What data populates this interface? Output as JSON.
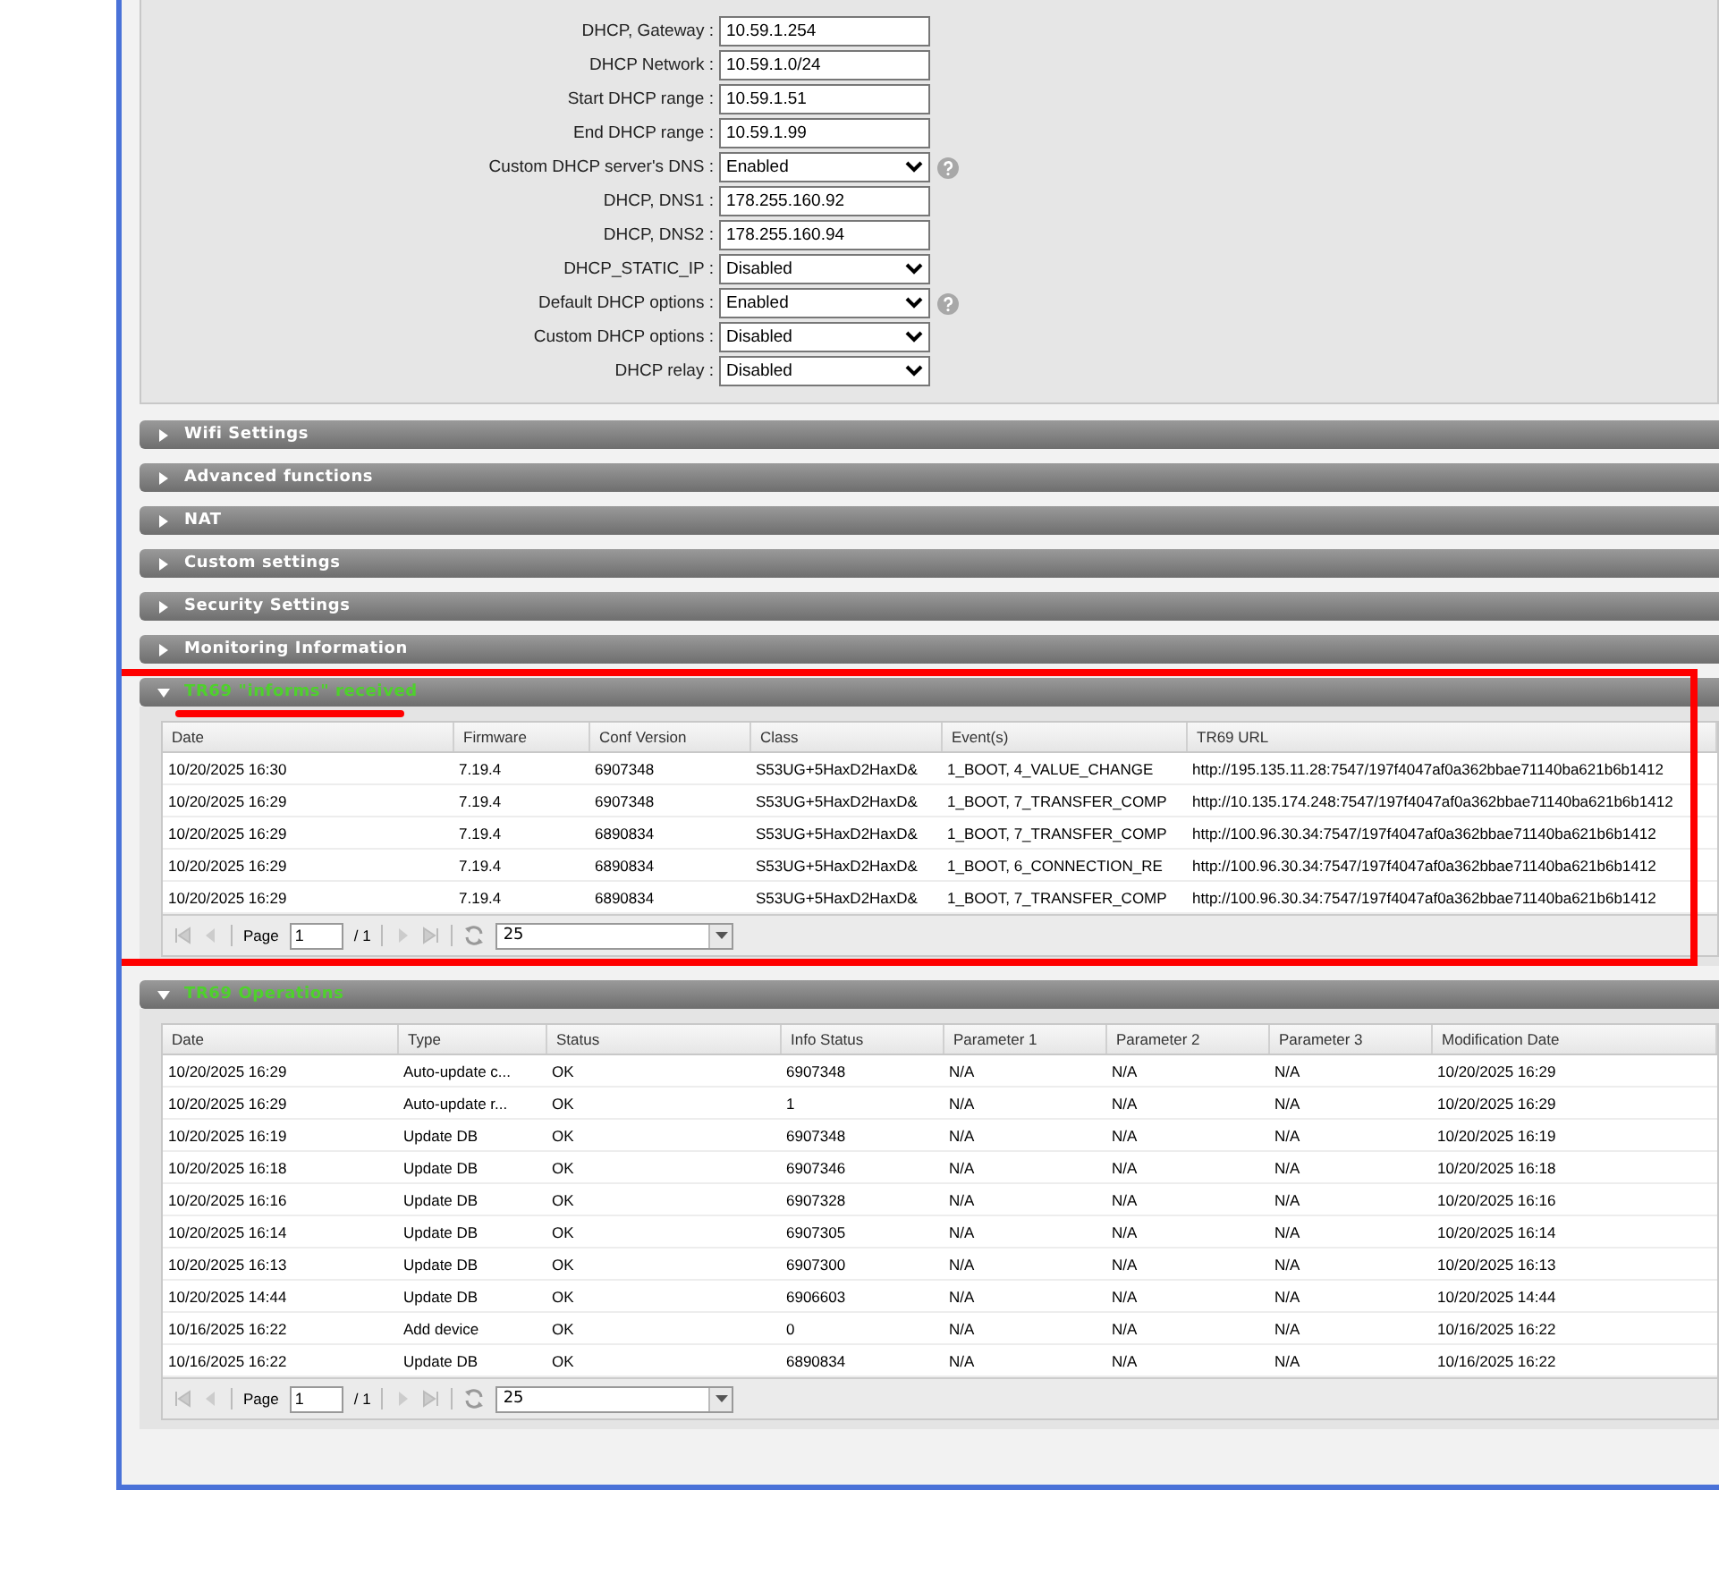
{
  "dhcp_fields": [
    {
      "label": "DHCP, Gateway :",
      "kind": "input",
      "value": "10.59.1.254",
      "help": false
    },
    {
      "label": "DHCP Network :",
      "kind": "input",
      "value": "10.59.1.0/24",
      "help": false
    },
    {
      "label": "Start DHCP range :",
      "kind": "input",
      "value": "10.59.1.51",
      "help": false
    },
    {
      "label": "End DHCP range :",
      "kind": "input",
      "value": "10.59.1.99",
      "help": false
    },
    {
      "label": "Custom DHCP server's DNS :",
      "kind": "select",
      "value": "Enabled",
      "help": true
    },
    {
      "label": "DHCP, DNS1 :",
      "kind": "input",
      "value": "178.255.160.92",
      "help": false
    },
    {
      "label": "DHCP, DNS2 :",
      "kind": "input",
      "value": "178.255.160.94",
      "help": false
    },
    {
      "label": "DHCP_STATIC_IP :",
      "kind": "select",
      "value": "Disabled",
      "help": false
    },
    {
      "label": "Default DHCP options :",
      "kind": "select",
      "value": "Enabled",
      "help": true
    },
    {
      "label": "Custom DHCP options :",
      "kind": "select",
      "value": "Disabled",
      "help": false
    },
    {
      "label": "DHCP relay :",
      "kind": "select",
      "value": "Disabled",
      "help": false
    }
  ],
  "sections": [
    {
      "title": "Wifi Settings",
      "expanded": false,
      "highlighted": false
    },
    {
      "title": "Advanced functions",
      "expanded": false,
      "highlighted": false
    },
    {
      "title": "NAT",
      "expanded": false,
      "highlighted": false
    },
    {
      "title": "Custom settings",
      "expanded": false,
      "highlighted": false
    },
    {
      "title": "Security Settings",
      "expanded": false,
      "highlighted": false
    },
    {
      "title": "Monitoring Information",
      "expanded": false,
      "highlighted": false
    },
    {
      "title": "TR69 \"informs\" received",
      "expanded": true,
      "highlighted": true,
      "table": {
        "columns": [
          "Date",
          "Firmware",
          "Conf Version",
          "Class",
          "Event(s)",
          "TR69 URL"
        ],
        "rows": [
          [
            "10/20/2025 16:30",
            "7.19.4",
            "6907348",
            "S53UG+5HaxD2HaxD&",
            "1_BOOT, 4_VALUE_CHANGE",
            "http://195.135.11.28:7547/197f4047af0a362bbae71140ba621b6b1412"
          ],
          [
            "10/20/2025 16:29",
            "7.19.4",
            "6907348",
            "S53UG+5HaxD2HaxD&",
            "1_BOOT, 7_TRANSFER_COMP",
            "http://10.135.174.248:7547/197f4047af0a362bbae71140ba621b6b1412"
          ],
          [
            "10/20/2025 16:29",
            "7.19.4",
            "6890834",
            "S53UG+5HaxD2HaxD&",
            "1_BOOT, 7_TRANSFER_COMP",
            "http://100.96.30.34:7547/197f4047af0a362bbae71140ba621b6b1412"
          ],
          [
            "10/20/2025 16:29",
            "7.19.4",
            "6890834",
            "S53UG+5HaxD2HaxD&",
            "1_BOOT, 6_CONNECTION_RE",
            "http://100.96.30.34:7547/197f4047af0a362bbae71140ba621b6b1412"
          ],
          [
            "10/20/2025 16:29",
            "7.19.4",
            "6890834",
            "S53UG+5HaxD2HaxD&",
            "1_BOOT, 7_TRANSFER_COMP",
            "http://100.96.30.34:7547/197f4047af0a362bbae71140ba621b6b1412"
          ]
        ]
      },
      "pager": {
        "page_label": "Page",
        "page": "1",
        "total": "/ 1",
        "page_size": "25"
      }
    },
    {
      "title": "TR69 Operations",
      "expanded": true,
      "highlighted": false,
      "table": {
        "columns": [
          "Date",
          "Type",
          "Status",
          "Info Status",
          "Parameter 1",
          "Parameter 2",
          "Parameter 3",
          "Modification Date"
        ],
        "rows": [
          [
            "10/20/2025 16:29",
            "Auto-update c...",
            "OK",
            "6907348",
            "N/A",
            "N/A",
            "N/A",
            "10/20/2025 16:29"
          ],
          [
            "10/20/2025 16:29",
            "Auto-update r...",
            "OK",
            "1",
            "N/A",
            "N/A",
            "N/A",
            "10/20/2025 16:29"
          ],
          [
            "10/20/2025 16:19",
            "Update DB",
            "OK",
            "6907348",
            "N/A",
            "N/A",
            "N/A",
            "10/20/2025 16:19"
          ],
          [
            "10/20/2025 16:18",
            "Update DB",
            "OK",
            "6907346",
            "N/A",
            "N/A",
            "N/A",
            "10/20/2025 16:18"
          ],
          [
            "10/20/2025 16:16",
            "Update DB",
            "OK",
            "6907328",
            "N/A",
            "N/A",
            "N/A",
            "10/20/2025 16:16"
          ],
          [
            "10/20/2025 16:14",
            "Update DB",
            "OK",
            "6907305",
            "N/A",
            "N/A",
            "N/A",
            "10/20/2025 16:14"
          ],
          [
            "10/20/2025 16:13",
            "Update DB",
            "OK",
            "6907300",
            "N/A",
            "N/A",
            "N/A",
            "10/20/2025 16:13"
          ],
          [
            "10/20/2025 14:44",
            "Update DB",
            "OK",
            "6906603",
            "N/A",
            "N/A",
            "N/A",
            "10/20/2025 14:44"
          ],
          [
            "10/16/2025 16:22",
            "Add device",
            "OK",
            "0",
            "N/A",
            "N/A",
            "N/A",
            "10/16/2025 16:22"
          ],
          [
            "10/16/2025 16:22",
            "Update DB",
            "OK",
            "6890834",
            "N/A",
            "N/A",
            "N/A",
            "10/16/2025 16:22"
          ]
        ]
      },
      "pager": {
        "page_label": "Page",
        "page": "1",
        "total": "/ 1",
        "page_size": "25"
      }
    }
  ]
}
